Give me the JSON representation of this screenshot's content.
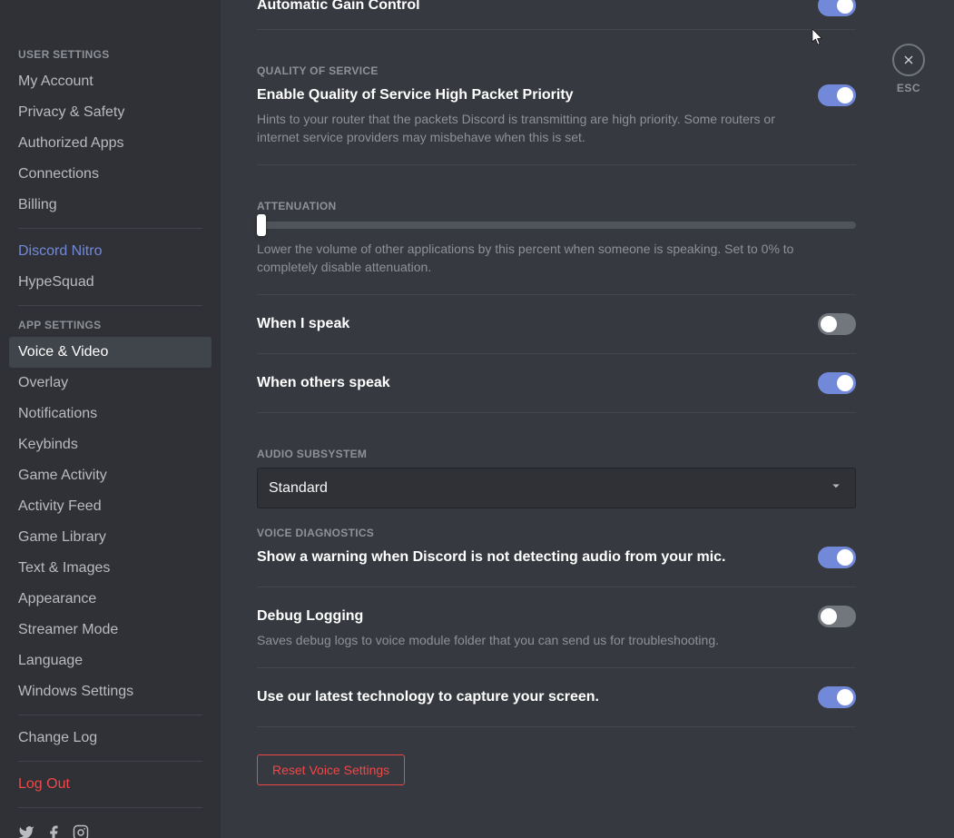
{
  "sidebar": {
    "user_settings_header": "USER SETTINGS",
    "app_settings_header": "APP SETTINGS",
    "items_user": [
      {
        "label": "My Account"
      },
      {
        "label": "Privacy & Safety"
      },
      {
        "label": "Authorized Apps"
      },
      {
        "label": "Connections"
      },
      {
        "label": "Billing"
      }
    ],
    "nitro": "Discord Nitro",
    "hypesquad": "HypeSquad",
    "items_app": [
      {
        "label": "Voice & Video"
      },
      {
        "label": "Overlay"
      },
      {
        "label": "Notifications"
      },
      {
        "label": "Keybinds"
      },
      {
        "label": "Game Activity"
      },
      {
        "label": "Activity Feed"
      },
      {
        "label": "Game Library"
      },
      {
        "label": "Text & Images"
      },
      {
        "label": "Appearance"
      },
      {
        "label": "Streamer Mode"
      },
      {
        "label": "Language"
      },
      {
        "label": "Windows Settings"
      }
    ],
    "change_log": "Change Log",
    "logout": "Log Out"
  },
  "main": {
    "agc_title": "Automatic Gain Control",
    "qos_header": "QUALITY OF SERVICE",
    "qos_title": "Enable Quality of Service High Packet Priority",
    "qos_desc": "Hints to your router that the packets Discord is transmitting are high priority. Some routers or internet service providers may misbehave when this is set.",
    "att_header": "ATTENUATION",
    "att_desc": "Lower the volume of other applications by this percent when someone is speaking. Set to 0% to completely disable attenuation.",
    "att_when_i": "When I speak",
    "att_when_others": "When others speak",
    "audio_sub_header": "AUDIO SUBSYSTEM",
    "audio_sub_value": "Standard",
    "diag_header": "VOICE DIAGNOSTICS",
    "diag_warning": "Show a warning when Discord is not detecting audio from your mic.",
    "debug_title": "Debug Logging",
    "debug_desc": "Saves debug logs to voice module folder that you can send us for troubleshooting.",
    "screen_title": "Use our latest technology to capture your screen.",
    "reset_btn": "Reset Voice Settings"
  },
  "close": {
    "esc": "ESC"
  },
  "toggles": {
    "agc": true,
    "qos": true,
    "when_i": false,
    "when_others": true,
    "warning": true,
    "debug": false,
    "screen": true
  },
  "slider": {
    "attenuation_percent": 0
  }
}
